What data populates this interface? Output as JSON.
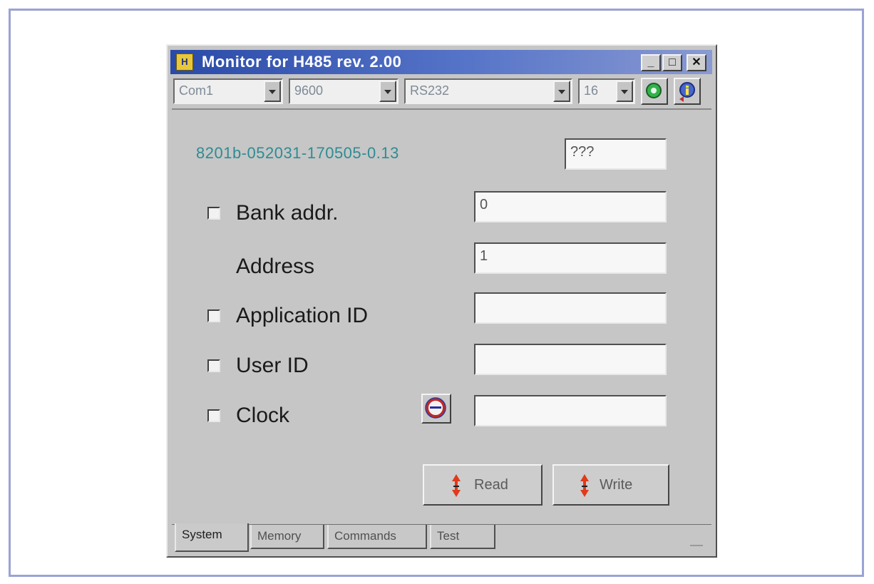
{
  "window": {
    "title": "Monitor for H485 rev. 2.00",
    "icon_glyph": "H",
    "controls": {
      "minimize": "_",
      "maximize": "□",
      "close": "✕"
    }
  },
  "toolbar": {
    "port": {
      "value": "Com1"
    },
    "baud": {
      "value": "9600"
    },
    "interface": {
      "value": "RS232"
    },
    "bits": {
      "value": "16"
    },
    "connect_icon": "green-circle-icon",
    "info_icon": "info-icon"
  },
  "system": {
    "serial_number": "8201b-052031-170505-0.13",
    "serial_field_value": "???",
    "bank_addr": {
      "label": "Bank addr.",
      "value": "0",
      "checked": false
    },
    "address": {
      "label": "Address",
      "value": "1"
    },
    "application_id": {
      "label": "Application ID",
      "value": "",
      "checked": false
    },
    "user_id": {
      "label": "User ID",
      "value": "",
      "checked": false
    },
    "clock": {
      "label": "Clock",
      "value": "",
      "checked": false,
      "icon": "clock-icon"
    },
    "read_label": "Read",
    "write_label": "Write"
  },
  "tabs": [
    {
      "label": "System",
      "active": true
    },
    {
      "label": "Memory",
      "active": false
    },
    {
      "label": "Commands",
      "active": false
    },
    {
      "label": "Test",
      "active": false
    }
  ],
  "colors": {
    "titlebar_start": "#2a4aa8",
    "serial_text": "#2e8c93",
    "read_write_arrow": "#e03a1a",
    "frame_border": "#9aa3d6"
  }
}
